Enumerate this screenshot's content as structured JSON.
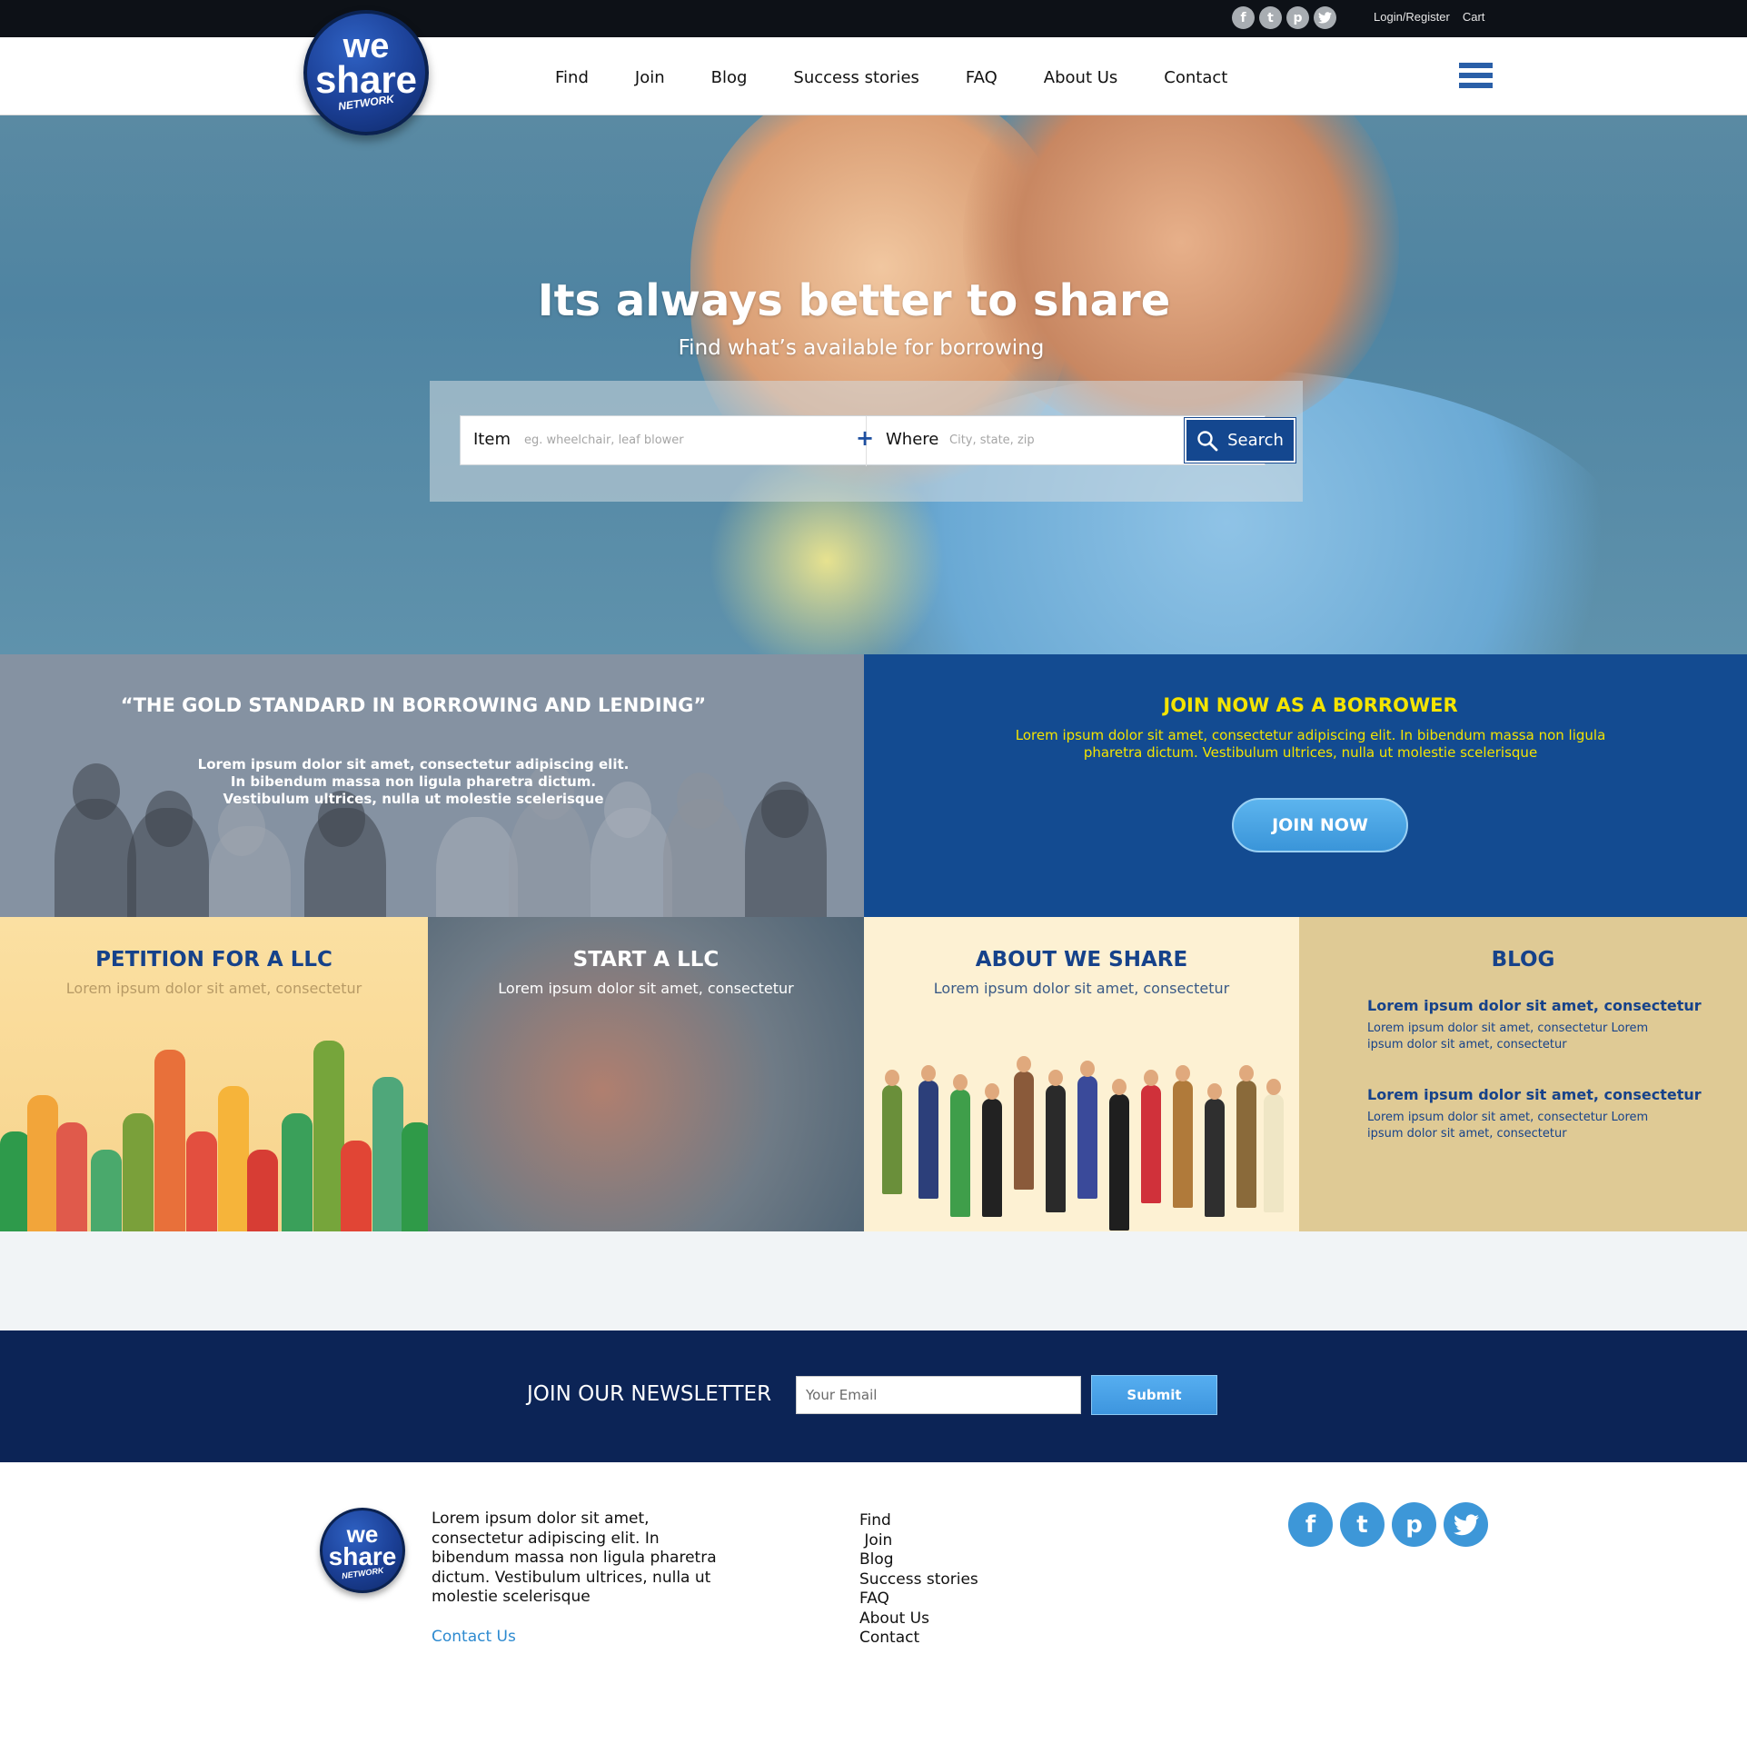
{
  "topbar": {
    "social": [
      {
        "icon": "facebook-icon",
        "glyph": "f"
      },
      {
        "icon": "tumblr-icon",
        "glyph": "t"
      },
      {
        "icon": "pinterest-icon",
        "glyph": "p"
      },
      {
        "icon": "twitter-icon",
        "glyph": "🐦"
      }
    ],
    "login": "Login/Register",
    "cart": "Cart"
  },
  "logo": {
    "line1": "we",
    "line2": "share",
    "line3": "NETWORK"
  },
  "nav": [
    "Find",
    "Join",
    "Blog",
    "Success stories",
    "FAQ",
    "About Us",
    "Contact"
  ],
  "hero": {
    "title": "Its always better to share",
    "subtitle": "Find what’s available for borrowing",
    "item_label": "Item",
    "item_placeholder": "eg. wheelchair, leaf blower",
    "plus": "+",
    "where_label": "Where",
    "where_placeholder": "City, state, zip",
    "search_button": "Search"
  },
  "gold": {
    "title": "“THE GOLD STANDARD IN BORROWING AND LENDING”",
    "text_lines": [
      "Lorem ipsum dolor sit amet, consectetur adipiscing elit.",
      "In bibendum massa non ligula pharetra dictum.",
      "Vestibulum ultrices, nulla ut molestie scelerisque"
    ]
  },
  "join": {
    "title": "JOIN NOW AS A BORROWER",
    "text": "Lorem ipsum dolor sit amet, consectetur adipiscing elit. In bibendum massa non ligula pharetra dictum. Vestibulum ultrices, nulla ut molestie scelerisque",
    "button": "JOIN NOW"
  },
  "panels": {
    "petition": {
      "title": "PETITION FOR A LLC",
      "sub": "Lorem ipsum dolor sit amet, consectetur"
    },
    "start": {
      "title": "START A LLC",
      "sub": "Lorem ipsum dolor sit amet, consectetur"
    },
    "about": {
      "title": "ABOUT WE SHARE",
      "sub": "Lorem ipsum dolor sit amet, consectetur"
    },
    "blog": {
      "title": "BLOG",
      "posts": [
        {
          "heading": "Lorem ipsum dolor sit amet, consectetur",
          "body": "Lorem ipsum dolor sit amet, consectetur Lorem ipsum dolor sit amet, consectetur"
        },
        {
          "heading": "Lorem ipsum dolor sit amet, consectetur",
          "body": "Lorem ipsum dolor sit amet, consectetur Lorem ipsum dolor sit amet, consectetur"
        }
      ]
    }
  },
  "newsletter": {
    "title": "JOIN OUR NEWSLETTER",
    "placeholder": "Your Email",
    "button": "Submit"
  },
  "footer": {
    "text": "Lorem ipsum dolor sit amet, consectetur adipiscing elit. In bibendum massa non ligula pharetra dictum. Vestibulum ultrices, nulla ut molestie scelerisque",
    "contact": "Contact Us",
    "links": [
      "Find",
      " Join",
      "Blog",
      "Success stories",
      "FAQ",
      "About Us",
      "Contact"
    ]
  },
  "colors": {
    "brand_blue": "#134b91",
    "navy": "#0c2456",
    "accent_yellow": "#f4e400",
    "button_blue": "#3d95de"
  }
}
